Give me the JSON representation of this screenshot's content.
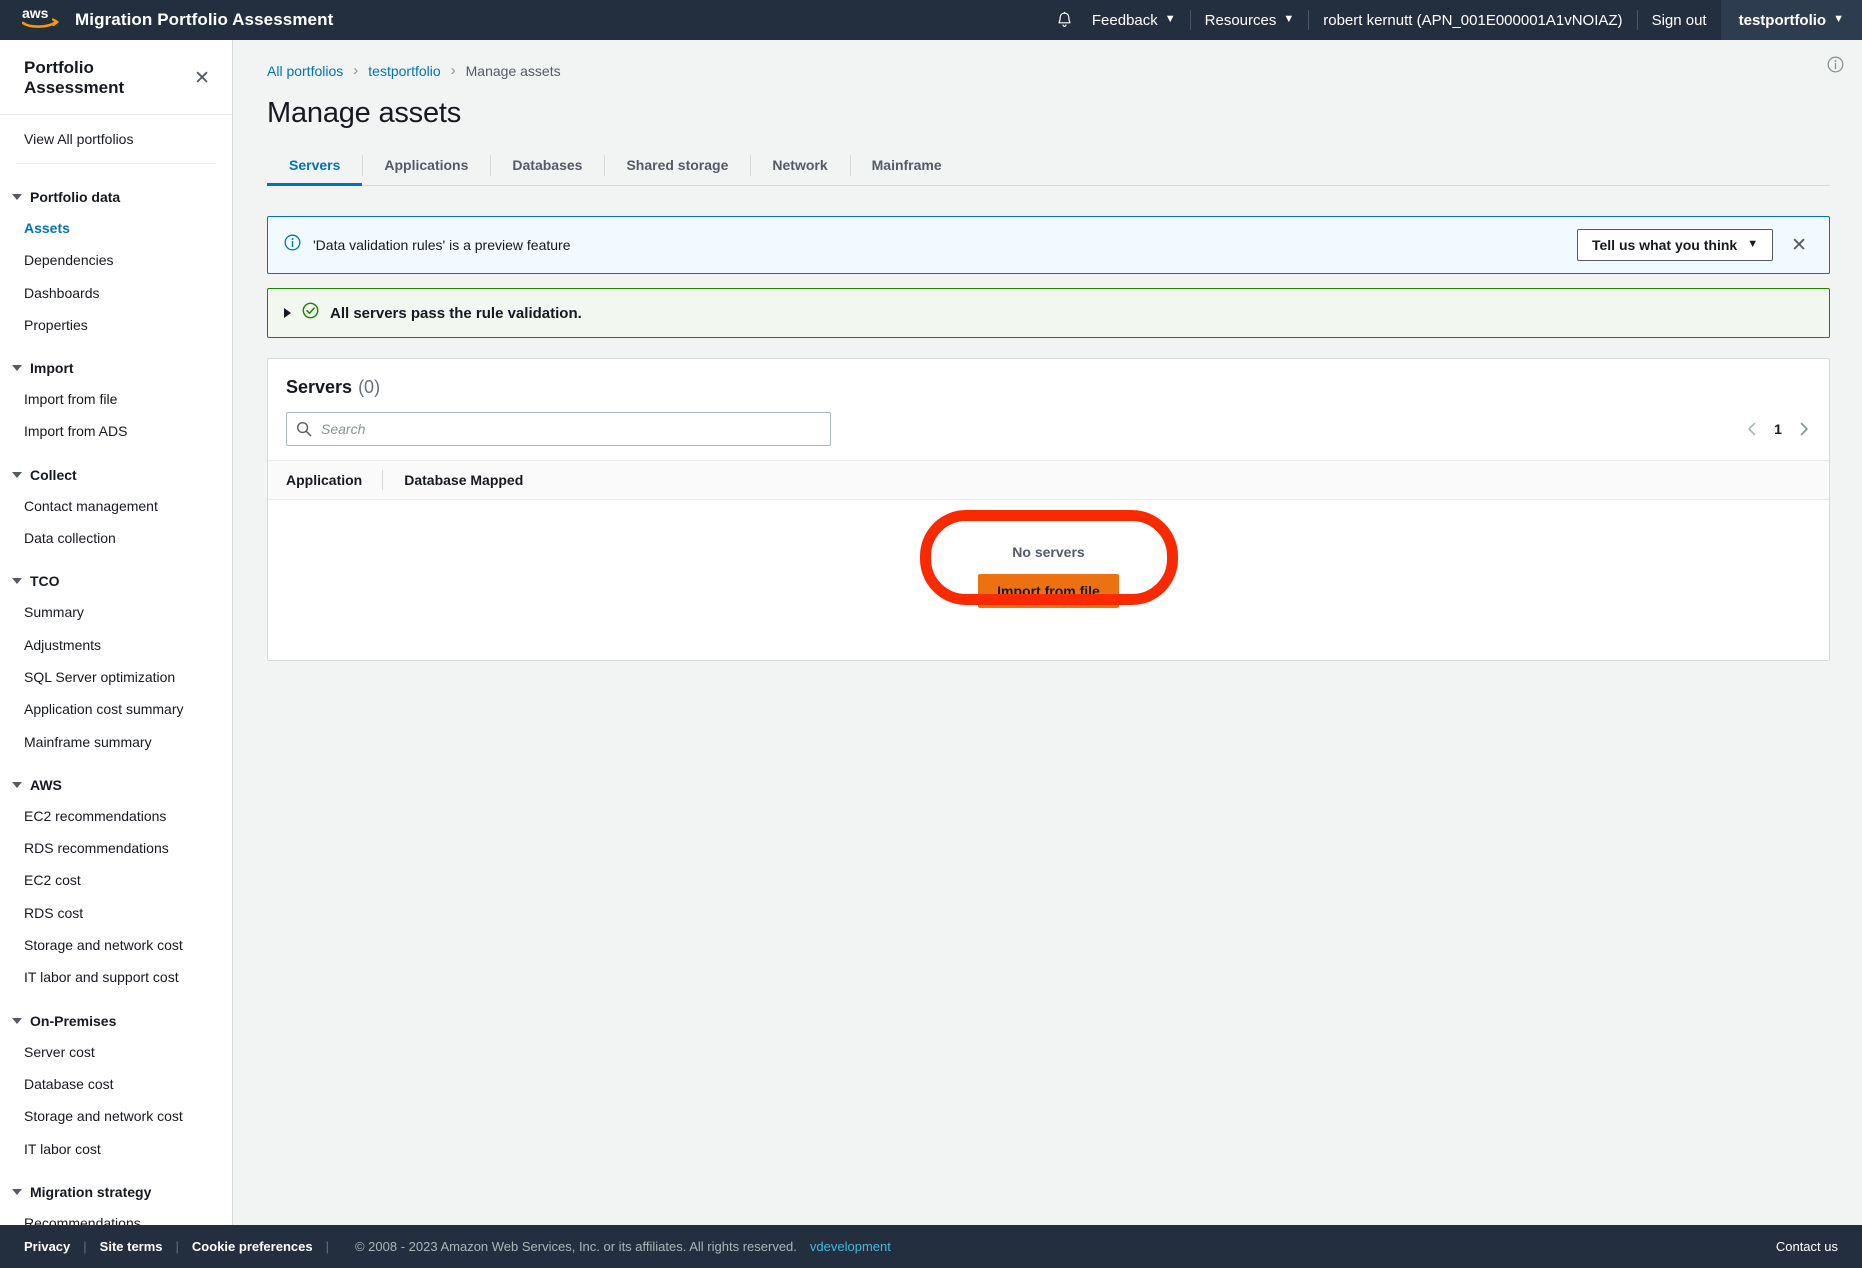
{
  "topnav": {
    "app_title": "Migration Portfolio Assessment",
    "logo_alt": "aws",
    "notifications_icon": "bell-icon",
    "feedback_label": "Feedback",
    "resources_label": "Resources",
    "account_label": "robert kernutt (APN_001E000001A1vNOIAZ)",
    "signout_label": "Sign out",
    "portfolio_label": "testportfolio",
    "caret": "▼"
  },
  "sidebar": {
    "title": "Portfolio Assessment",
    "close_icon": "✕",
    "view_all_label": "View All portfolios",
    "groups": [
      {
        "label": "Portfolio data",
        "items": [
          {
            "label": "Assets",
            "active": true
          },
          {
            "label": "Dependencies",
            "active": false
          },
          {
            "label": "Dashboards",
            "active": false
          },
          {
            "label": "Properties",
            "active": false
          }
        ]
      },
      {
        "label": "Import",
        "items": [
          {
            "label": "Import from file",
            "active": false
          },
          {
            "label": "Import from ADS",
            "active": false
          }
        ]
      },
      {
        "label": "Collect",
        "items": [
          {
            "label": "Contact management",
            "active": false
          },
          {
            "label": "Data collection",
            "active": false
          }
        ]
      },
      {
        "label": "TCO",
        "items": [
          {
            "label": "Summary",
            "active": false
          },
          {
            "label": "Adjustments",
            "active": false
          },
          {
            "label": "SQL Server optimization",
            "active": false
          },
          {
            "label": "Application cost summary",
            "active": false
          },
          {
            "label": "Mainframe summary",
            "active": false
          }
        ]
      },
      {
        "label": "AWS",
        "items": [
          {
            "label": "EC2 recommendations",
            "active": false
          },
          {
            "label": "RDS recommendations",
            "active": false
          },
          {
            "label": "EC2 cost",
            "active": false
          },
          {
            "label": "RDS cost",
            "active": false
          },
          {
            "label": "Storage and network cost",
            "active": false
          },
          {
            "label": "IT labor and support cost",
            "active": false
          }
        ]
      },
      {
        "label": "On-Premises",
        "items": [
          {
            "label": "Server cost",
            "active": false
          },
          {
            "label": "Database cost",
            "active": false
          },
          {
            "label": "Storage and network cost",
            "active": false
          },
          {
            "label": "IT labor cost",
            "active": false
          }
        ]
      },
      {
        "label": "Migration strategy",
        "items": [
          {
            "label": "Recommendations",
            "active": false
          }
        ]
      }
    ]
  },
  "breadcrumb": [
    {
      "label": "All portfolios",
      "current": false
    },
    {
      "label": "testportfolio",
      "current": false
    },
    {
      "label": "Manage assets",
      "current": true
    }
  ],
  "page": {
    "title": "Manage assets",
    "info_icon": "info-circle-icon"
  },
  "tabs": [
    {
      "label": "Servers",
      "active": true
    },
    {
      "label": "Applications",
      "active": false
    },
    {
      "label": "Databases",
      "active": false
    },
    {
      "label": "Shared storage",
      "active": false
    },
    {
      "label": "Network",
      "active": false
    },
    {
      "label": "Mainframe",
      "active": false
    }
  ],
  "preview_banner": {
    "icon": "info-circle-icon",
    "text": "'Data validation rules' is a preview feature",
    "button_label": "Tell us what you think",
    "button_caret": "▼",
    "close_icon": "✕"
  },
  "validation_banner": {
    "expand_icon": "triangle-right-icon",
    "status_icon": "check-circle-icon",
    "text": "All servers pass the rule validation."
  },
  "servers_card": {
    "title": "Servers",
    "count": "(0)",
    "search": {
      "placeholder": "Search",
      "value": "",
      "icon": "search-icon"
    },
    "pagination": {
      "prev_icon": "chevron-left-icon",
      "page": "1",
      "next_icon": "chevron-right-icon"
    },
    "columns": [
      "Application",
      "Database Mapped"
    ],
    "rows": [],
    "empty": {
      "text": "No servers",
      "button_label": "Import from file"
    }
  },
  "annotation": {
    "shape": "oval-highlight",
    "color": "#fa2a00"
  },
  "footer": {
    "privacy": "Privacy",
    "site_terms": "Site terms",
    "cookie_preferences": "Cookie preferences",
    "copyright": "© 2008 - 2023 Amazon Web Services, Inc. or its affiliates. All rights reserved.",
    "stage": "vdevelopment",
    "contact": "Contact us",
    "sep": "|"
  },
  "colors": {
    "nav_bg": "#232f3e",
    "accent_link": "#0073bb",
    "primary_button": "#ec7211",
    "success": "#1d8102",
    "annotation": "#fa2a00"
  }
}
